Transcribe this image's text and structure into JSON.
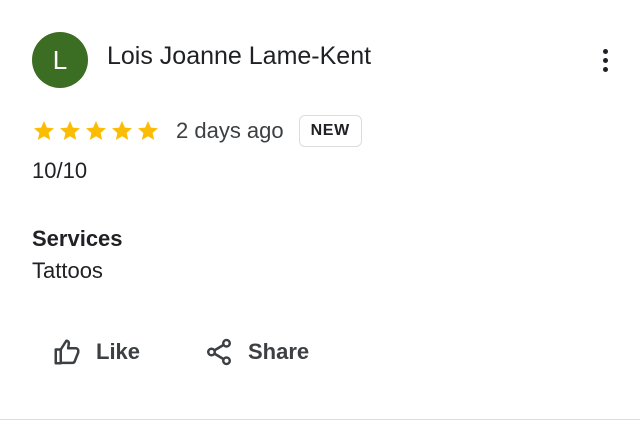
{
  "review": {
    "author_initial": "L",
    "author_name": "Lois Joanne Lame-Kent",
    "avatar_color": "#3b6e22",
    "rating": 5,
    "rating_max": 5,
    "star_color": "#fbbc04",
    "relative_date": "2 days ago",
    "badge": "NEW",
    "text": "10/10",
    "services_label": "Services",
    "services_value": "Tattoos"
  },
  "actions": {
    "like_label": "Like",
    "like_icon": "thumbs-up-icon",
    "share_label": "Share",
    "share_icon": "share-icon",
    "menu_icon": "more-vertical-icon"
  }
}
